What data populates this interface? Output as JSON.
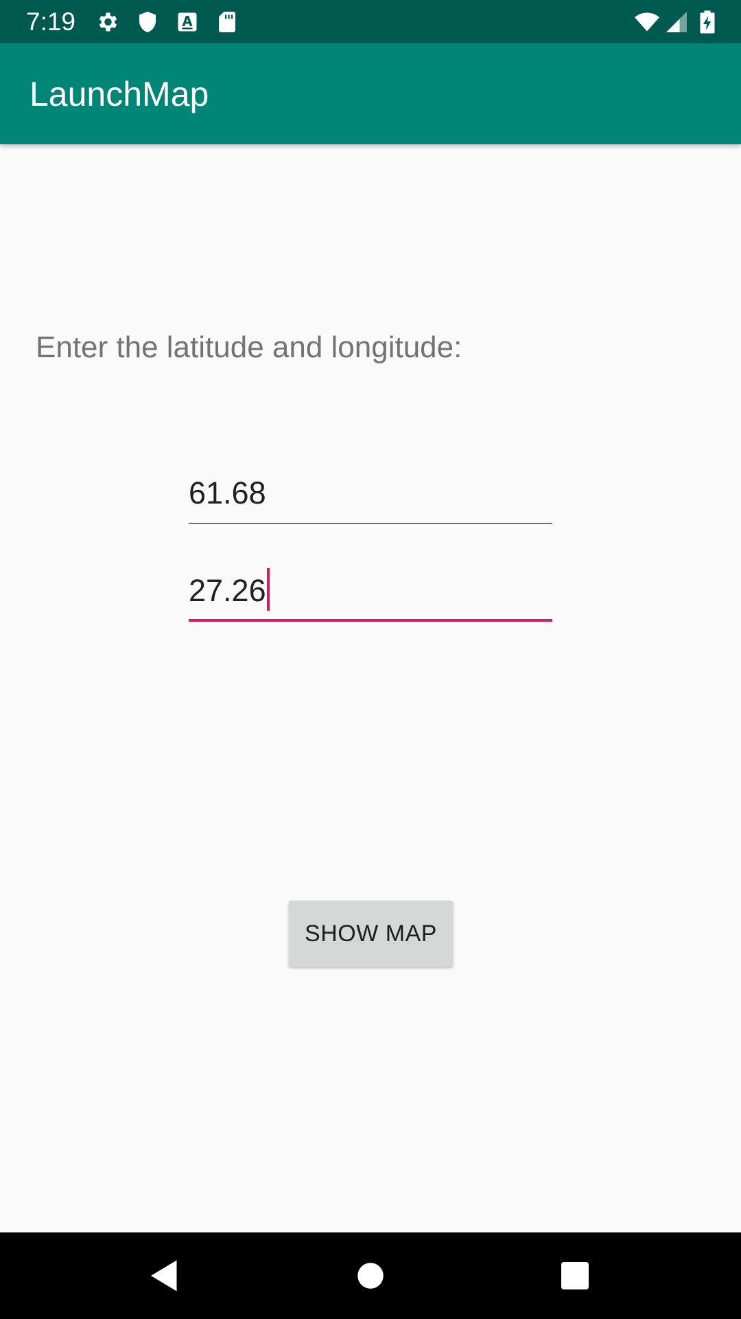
{
  "status_bar": {
    "time": "7:19",
    "icons": [
      "settings-gear-icon",
      "shield-icon",
      "font-a-icon",
      "sd-card-icon",
      "wifi-icon",
      "cell-signal-icon",
      "battery-charging-icon"
    ]
  },
  "app_bar": {
    "title": "LaunchMap"
  },
  "main": {
    "prompt": "Enter the latitude and longitude:",
    "latitude_value": "61.68",
    "longitude_value": "27.26",
    "show_map_label": "SHOW MAP"
  },
  "nav_bar": {
    "icons": [
      "back-icon",
      "home-icon",
      "recents-icon"
    ]
  },
  "colors": {
    "status_bar": "#00594f",
    "app_bar": "#008577",
    "accent": "#d81b60",
    "background": "#fafafa",
    "button": "#d6d7d7"
  }
}
